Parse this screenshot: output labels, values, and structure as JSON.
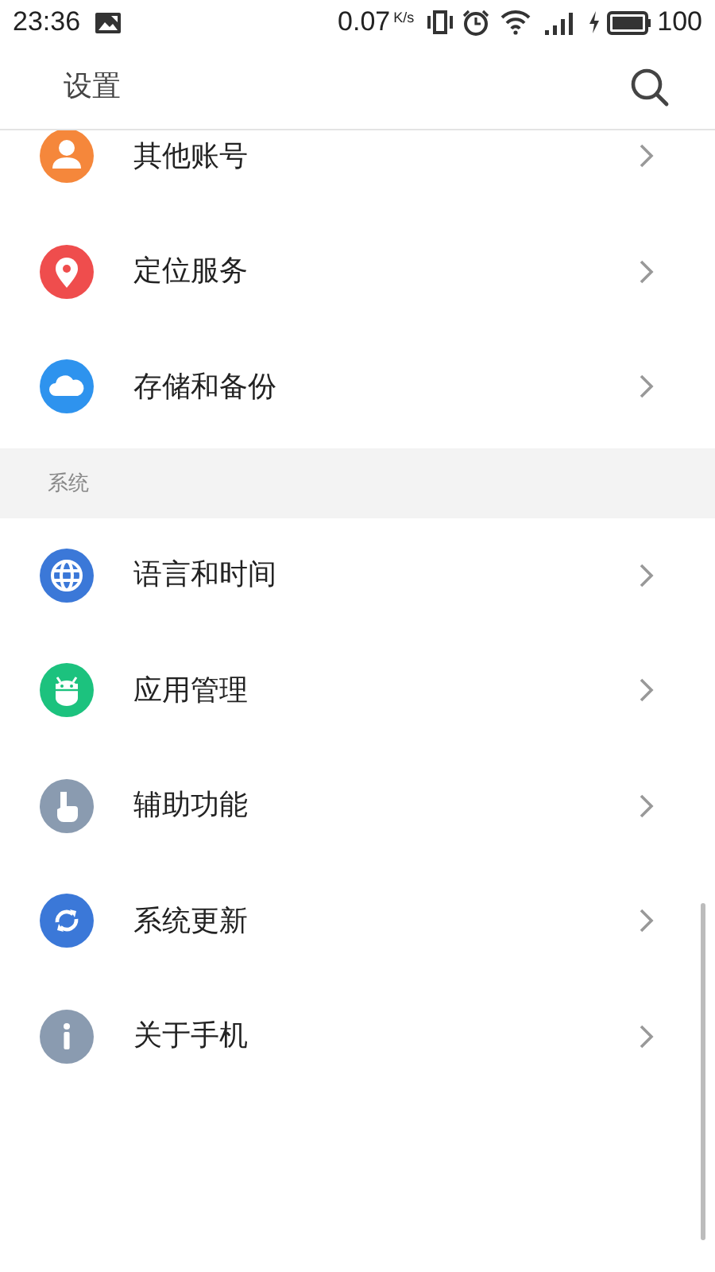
{
  "status_bar": {
    "time": "23:36",
    "speed": "0.07",
    "speed_unit": "K/s",
    "battery": "100"
  },
  "header": {
    "title": "设置"
  },
  "groups": [
    {
      "items": [
        {
          "label": "其他账号",
          "kind": "account",
          "color": "#f5873b"
        },
        {
          "label": "定位服务",
          "kind": "location",
          "color": "#ef4d4d"
        },
        {
          "label": "存储和备份",
          "kind": "cloud",
          "color": "#2e93ee"
        }
      ]
    },
    {
      "title": "系统",
      "items": [
        {
          "label": "语言和时间",
          "kind": "globe",
          "color": "#3b78d8"
        },
        {
          "label": "应用管理",
          "kind": "android",
          "color": "#1cc27e"
        },
        {
          "label": "辅助功能",
          "kind": "hand",
          "color": "#8a9bb0"
        },
        {
          "label": "系统更新",
          "kind": "sync",
          "color": "#3b78d8"
        },
        {
          "label": "关于手机",
          "kind": "info",
          "color": "#8a9bb0"
        }
      ]
    }
  ]
}
